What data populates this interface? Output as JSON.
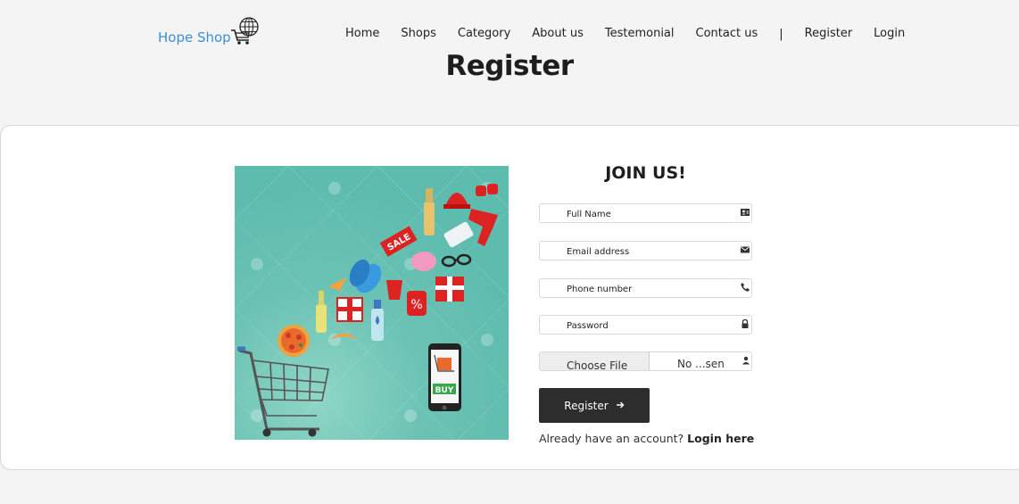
{
  "logo": {
    "text": "Hope Shop",
    "icon": "globe-cart-icon",
    "color": "#3a8fd6"
  },
  "nav": {
    "items": [
      "Home",
      "Shops",
      "Category",
      "About us",
      "Testemonial",
      "Contact us"
    ],
    "separator": "|",
    "register": "Register",
    "login": "Login"
  },
  "page_title": "Register",
  "illustration": {
    "sale_tag": "SALE",
    "buy_label": "BUY",
    "percent": "%",
    "background": "#5ebcae"
  },
  "form": {
    "title": "JOIN US!",
    "full_name_placeholder": "Full Name",
    "full_name_icon": "contact-card-icon",
    "email_placeholder": "Email address",
    "email_icon": "envelope-icon",
    "phone_placeholder": "Phone number",
    "phone_icon": "phone-icon",
    "password_placeholder": "Password",
    "password_icon": "lock-icon",
    "file_button": "Choose File",
    "file_status": "No ...sen",
    "file_icon": "user-icon",
    "submit": "Register",
    "submit_icon": "arrow-right-icon",
    "account_prompt": "Already have an account?",
    "login_link": "Login here"
  }
}
